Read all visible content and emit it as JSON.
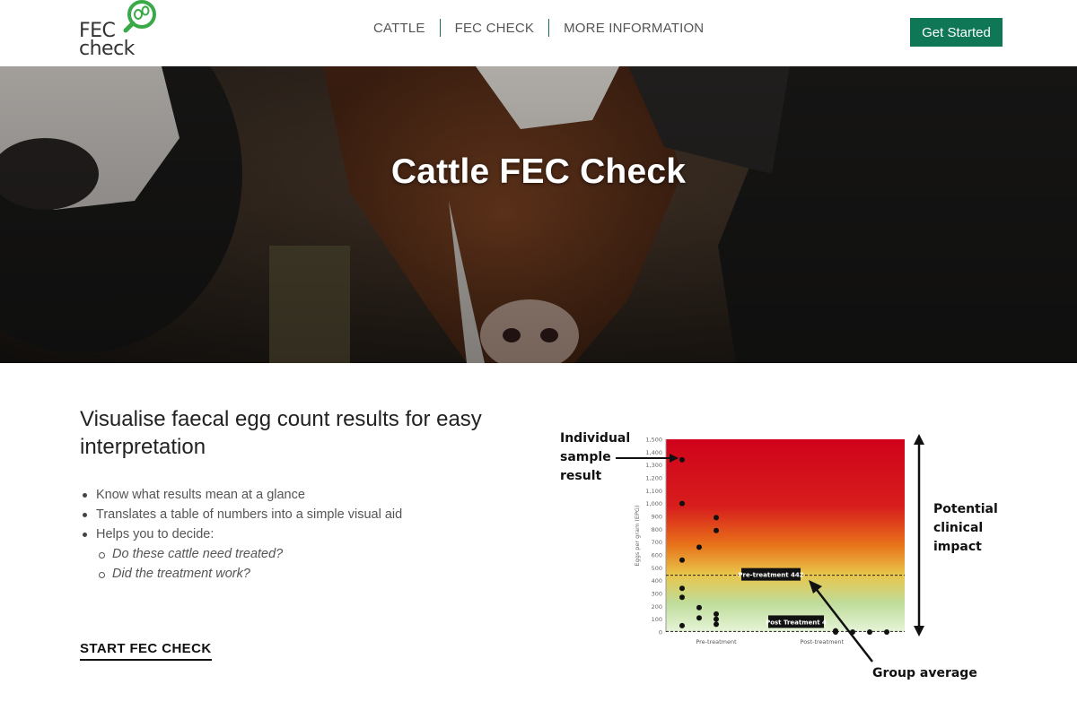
{
  "header": {
    "logo": {
      "line1": "FEC",
      "line2": "check"
    },
    "nav": [
      {
        "label": "CATTLE"
      },
      {
        "label": "FEC CHECK"
      },
      {
        "label": "MORE INFORMATION"
      }
    ],
    "cta_label": "Get Started",
    "accent": "#0f7756"
  },
  "hero": {
    "title": "Cattle FEC Check"
  },
  "main": {
    "heading": "Visualise faecal egg count results for easy interpretation",
    "bullets": [
      "Know what results mean at a glance",
      "Translates a table of numbers into a simple visual aid",
      "Helps you to decide:"
    ],
    "sub_bullets": [
      "Do these cattle need treated?",
      "Did the treatment work?"
    ],
    "start_link": "START FEC CHECK"
  },
  "chart_data": {
    "type": "scatter",
    "ylabel": "Eggs per gram (EPG)",
    "ylim": [
      0,
      1500
    ],
    "yticks": [
      "0",
      "100",
      "200",
      "300",
      "400",
      "500",
      "600",
      "700",
      "800",
      "900",
      "1,000",
      "1,100",
      "1,200",
      "1,300",
      "1,400",
      "1,500"
    ],
    "categories": [
      "Pre-treatment",
      "Post-treatment"
    ],
    "background_gradient": [
      "#d0021b",
      "#e8731a",
      "#e9c54a",
      "#bfdc9a",
      "#e6f4d9"
    ],
    "points": [
      {
        "x": 0,
        "y": 1340
      },
      {
        "x": 0,
        "y": 1000
      },
      {
        "x": 0,
        "y": 560
      },
      {
        "x": 0,
        "y": 340
      },
      {
        "x": 0,
        "y": 270
      },
      {
        "x": 0,
        "y": 50
      },
      {
        "x": 0.5,
        "y": 660
      },
      {
        "x": 0.5,
        "y": 190
      },
      {
        "x": 0.5,
        "y": 110
      },
      {
        "x": 1,
        "y": 890
      },
      {
        "x": 1,
        "y": 790
      },
      {
        "x": 1,
        "y": 140
      },
      {
        "x": 1,
        "y": 100
      },
      {
        "x": 1,
        "y": 60
      },
      {
        "x": 4.5,
        "y": 10
      },
      {
        "x": 4.5,
        "y": 0
      },
      {
        "x": 5,
        "y": 0
      },
      {
        "x": 5.5,
        "y": 0
      },
      {
        "x": 6,
        "y": 0
      }
    ],
    "reference_lines": [
      {
        "name": "Pre-treatment 442",
        "value": 442
      },
      {
        "name": "Post Treatment 4",
        "value": 4
      }
    ],
    "annotations": {
      "individual": "Individual sample result",
      "potential": "Potential clinical impact",
      "group": "Group average"
    }
  }
}
